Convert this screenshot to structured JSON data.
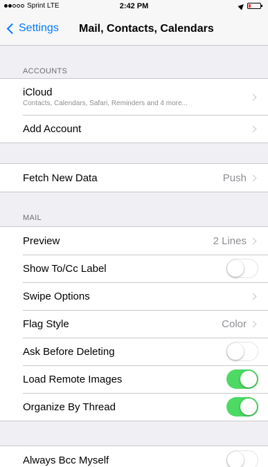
{
  "status_bar": {
    "carrier": "Sprint",
    "network": "LTE",
    "time": "2:42 PM",
    "signal_bars": 2,
    "signal_total": 5
  },
  "nav": {
    "back_label": "Settings",
    "title": "Mail, Contacts, Calendars"
  },
  "accounts": {
    "header": "ACCOUNTS",
    "icloud": {
      "label": "iCloud",
      "subtitle": "Contacts, Calendars, Safari, Reminders and 4 more..."
    },
    "add_account": {
      "label": "Add Account"
    }
  },
  "fetch": {
    "label": "Fetch New Data",
    "value": "Push"
  },
  "mail": {
    "header": "MAIL",
    "preview": {
      "label": "Preview",
      "value": "2 Lines"
    },
    "show_tocc": {
      "label": "Show To/Cc Label",
      "enabled": false
    },
    "swipe_options": {
      "label": "Swipe Options"
    },
    "flag_style": {
      "label": "Flag Style",
      "value": "Color"
    },
    "ask_before_deleting": {
      "label": "Ask Before Deleting",
      "enabled": false
    },
    "load_remote_images": {
      "label": "Load Remote Images",
      "enabled": true
    },
    "organize_by_thread": {
      "label": "Organize By Thread",
      "enabled": true
    }
  },
  "bcc": {
    "label": "Always Bcc Myself",
    "enabled": false
  },
  "colors": {
    "accent": "#007aff",
    "switch_on": "#4cd964",
    "background": "#efeff4"
  }
}
